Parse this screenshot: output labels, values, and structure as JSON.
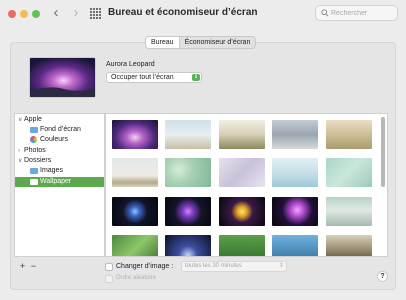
{
  "window": {
    "title": "Bureau et économiseur d’écran"
  },
  "search": {
    "placeholder": "Rechercher"
  },
  "tabs": [
    {
      "label": "Bureau",
      "active": true
    },
    {
      "label": "Économiseur d’écran",
      "active": false
    }
  ],
  "current": {
    "wallpaper_name": "Aurora Leopard",
    "fill_mode": "Occuper tout l’écran"
  },
  "sidebar": {
    "items": [
      {
        "label": "Apple",
        "kind": "group"
      },
      {
        "label": "Fond d’écran",
        "kind": "child",
        "icon": "folder-icon"
      },
      {
        "label": "Couleurs",
        "kind": "child",
        "icon": "colors-icon"
      },
      {
        "label": "Photos",
        "kind": "plain"
      },
      {
        "label": "Dossiers",
        "kind": "group"
      },
      {
        "label": "Images",
        "kind": "child",
        "icon": "folder-icon"
      },
      {
        "label": "Wallpaper",
        "kind": "child",
        "icon": "folder-icon",
        "selected": true
      }
    ]
  },
  "controls": {
    "add": "+",
    "remove": "−",
    "change_image_label": "Changer d’image :",
    "interval": "toutes les 30 minutes",
    "random_label": "Ordre aléatoire",
    "help": "?"
  },
  "colors": {
    "accent": "#5ea84e"
  }
}
